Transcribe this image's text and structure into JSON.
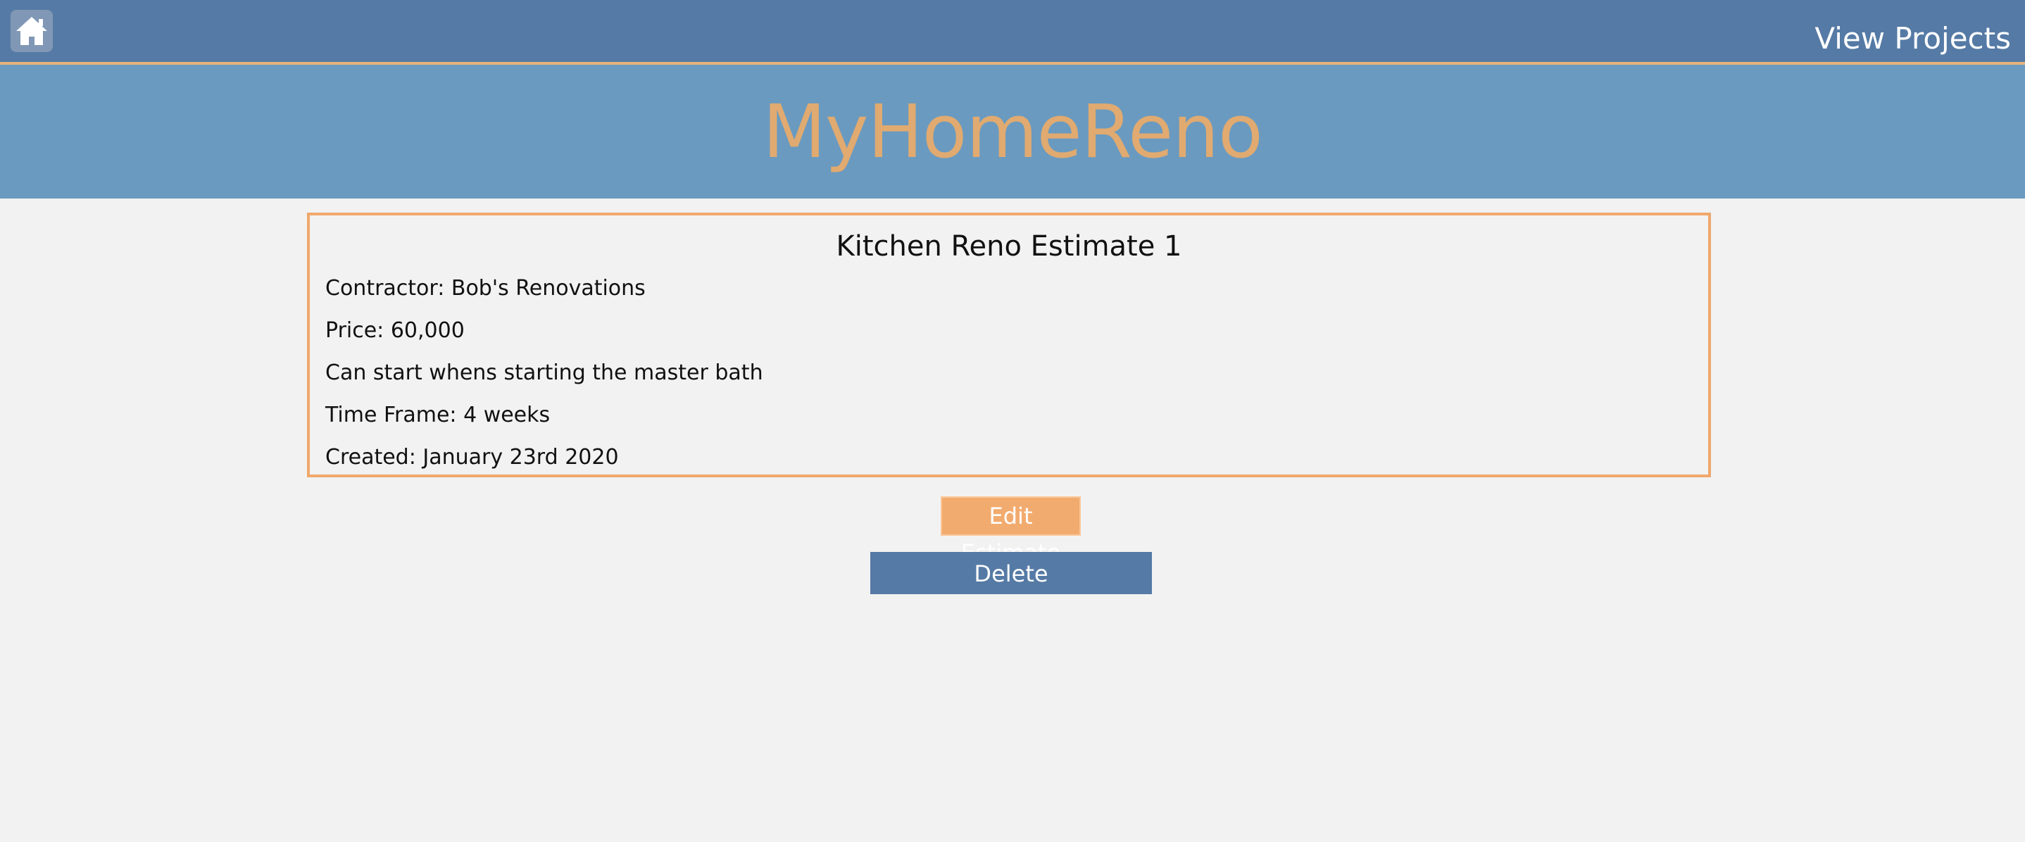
{
  "header": {
    "home_icon": "home-icon",
    "nav_link": "View Projects"
  },
  "banner": {
    "brand": "MyHomeReno"
  },
  "estimate": {
    "title": "Kitchen Reno Estimate 1",
    "contractor": "Contractor: Bob's Renovations",
    "price": "Price: 60,000",
    "note": "Can start whens starting the master bath",
    "time_frame": "Time Frame: 4 weeks",
    "created": "Created: January 23rd 2020"
  },
  "actions": {
    "edit_label": "Edit Estimate",
    "delete_label": "Delete"
  },
  "colors": {
    "topbar": "#557aa5",
    "banner": "#6a9ac0",
    "brand": "#e0aa70",
    "accent": "#f2ab6e",
    "background": "#f2f2f2"
  }
}
